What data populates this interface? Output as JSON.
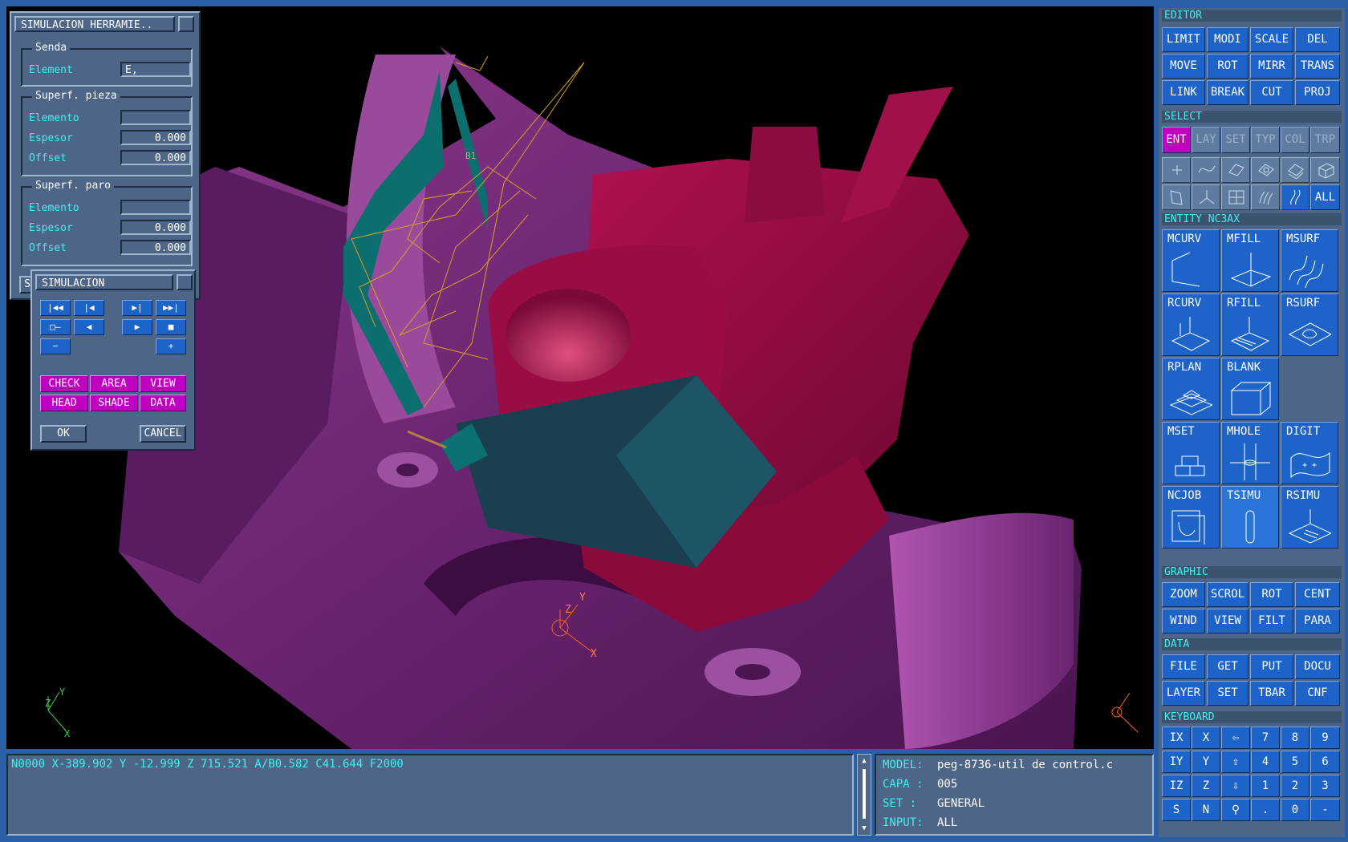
{
  "viewport_label": "B1",
  "tool_dialog": {
    "title": "SIMULACION HERRAMIE..",
    "senda": {
      "label": "Senda",
      "element_label": "Element",
      "element_value": "E,"
    },
    "superf_pieza": {
      "label": "Superf. pieza",
      "elemento_label": "Elemento",
      "elemento_value": "",
      "espesor_label": "Espesor",
      "espesor_value": "0.000",
      "offset_label": "Offset",
      "offset_value": "0.000"
    },
    "superf_paro": {
      "label": "Superf. paro",
      "elemento_label": "Elemento",
      "elemento_value": "",
      "espesor_label": "Espesor",
      "espesor_value": "0.000",
      "offset_label": "Offset",
      "offset_value": "0.000"
    },
    "partial_button": "S"
  },
  "sim_dialog": {
    "title": "SIMULACION",
    "transport": {
      "first": "|◀◀",
      "prev": "|◀",
      "next": "▶|",
      "last": "▶▶|",
      "slider": "□—",
      "back": "◀",
      "play": "▶",
      "stop": "■",
      "minus": "−",
      "plus": "+"
    },
    "modes": [
      "CHECK",
      "AREA",
      "VIEW",
      "HEAD",
      "SHADE",
      "DATA"
    ],
    "ok": "OK",
    "cancel": "CANCEL"
  },
  "editor": {
    "title": "EDITOR",
    "buttons": [
      "LIMIT",
      "MODI",
      "SCALE",
      "DEL",
      "MOVE",
      "ROT",
      "MIRR",
      "TRANS",
      "LINK",
      "BREAK",
      "CUT",
      "PROJ"
    ]
  },
  "select": {
    "title": "SELECT",
    "buttons": [
      "ENT",
      "LAY",
      "SET",
      "TYP",
      "COL",
      "TRP"
    ],
    "all": "ALL"
  },
  "entity": {
    "title": "ENTITY  NC3AX",
    "buttons": [
      "MCURV",
      "MFILL",
      "MSURF",
      "RCURV",
      "RFILL",
      "RSURF",
      "RPLAN",
      "BLANK",
      "MSET",
      "MHOLE",
      "DIGIT",
      "NCJOB",
      "TSIMU",
      "RSIMU"
    ]
  },
  "graphic": {
    "title": "GRAPHIC",
    "buttons": [
      "ZOOM",
      "SCROL",
      "ROT",
      "CENT",
      "WIND",
      "VIEW",
      "FILT",
      "PARA"
    ]
  },
  "data_sec": {
    "title": "DATA",
    "buttons": [
      "FILE",
      "GET",
      "PUT",
      "DOCU",
      "LAYER",
      "SET",
      "TBAR",
      "CNF"
    ]
  },
  "keyboard": {
    "title": "KEYBOARD",
    "keys": [
      "IX",
      "X",
      "⇦",
      "7",
      "8",
      "9",
      "IY",
      "Y",
      "⇧",
      "4",
      "5",
      "6",
      "IZ",
      "Z",
      "⇩",
      "1",
      "2",
      "3",
      "S",
      "N",
      "⚲",
      ".",
      "0",
      "-"
    ]
  },
  "command_line": "N0000 X-389.902 Y -12.999 Z 715.521 A/B0.582 C41.644 F2000",
  "info": {
    "model_label": "MODEL:",
    "model_value": "peg-8736-util de control.c",
    "capa_label": "CAPA :",
    "capa_value": "005",
    "set_label": "SET  :",
    "set_value": "GENERAL",
    "input_label": "INPUT:",
    "input_value": "ALL"
  },
  "axes": {
    "x": "X",
    "y": "Y",
    "z": "Z"
  },
  "colors": {
    "accent_cyan": "#3ff0ee",
    "button_blue": "#1e64c8",
    "magenta": "#c000c0",
    "panel": "#4d6687"
  }
}
